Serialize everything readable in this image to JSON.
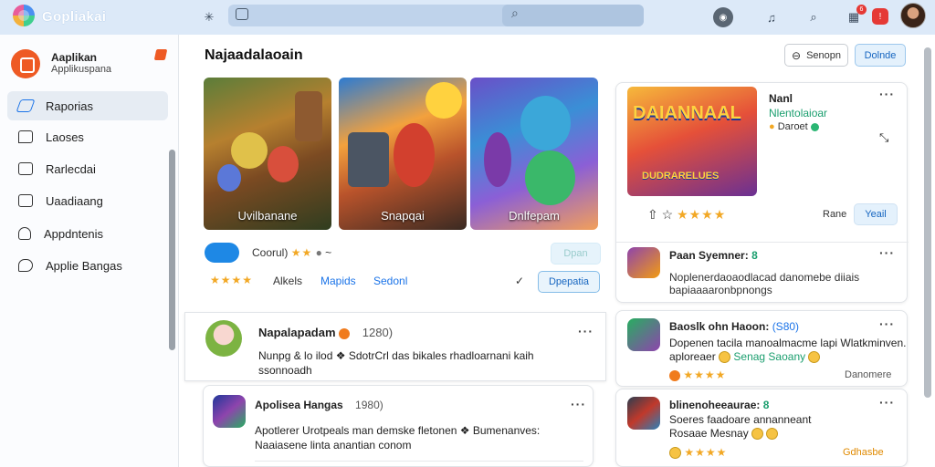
{
  "app": {
    "title": "Gopliakai"
  },
  "search": {
    "placeholder": ""
  },
  "notifications": {
    "count": "6"
  },
  "profile": {
    "name": "Aaplikan",
    "subtitle": "Applikuspana"
  },
  "sidebar": {
    "items": [
      {
        "label": "Raporias",
        "icon": "pencil-icon",
        "active": true
      },
      {
        "label": "Laoses",
        "icon": "chat-icon"
      },
      {
        "label": "Rarlecdai",
        "icon": "pencil-square-icon"
      },
      {
        "label": "Uaadiaang",
        "icon": "folder-icon"
      },
      {
        "label": "Appdntenis",
        "icon": "person-icon"
      },
      {
        "label": "Applie Bangas",
        "icon": "bubble-icon"
      }
    ]
  },
  "main": {
    "title": "Najaadalaoain",
    "header_buttons": {
      "outline": "Senopn",
      "primary": "Dolnde"
    },
    "featured": {
      "thumbnails": [
        {
          "label": "Uvilbanane"
        },
        {
          "label": "Snapqai"
        },
        {
          "label": "Dnlfepam"
        }
      ],
      "meta_label": "Coorul)",
      "meta_extra": "~",
      "disabled_button": "Dpan",
      "links": [
        "Alkels",
        "Mapids",
        "Sedonl"
      ],
      "rating_stars": "★★★★",
      "action_button": "Dpepatia",
      "chevron": "✓"
    },
    "side_feature": {
      "banner_text": "DAIANNAAL",
      "banner_sub": "DUDRARELUES",
      "title": "Nanl",
      "subtitle": "Nlentolaioar",
      "meta": "Daroet",
      "row_label": "Rane",
      "button": "Yeail",
      "stars": "★★★★"
    },
    "posts": [
      {
        "title": "Napalapadam",
        "num": "1280)",
        "body1": "Nunpg & lo ilod ❖ SdotrCrl das bikales rhadloarnani kaih",
        "body2": "ssonnoadh"
      },
      {
        "title": "Apolisea Hangas",
        "num": "1980)",
        "body1": "Apotlerer  Urotpeals man demske fletonen ❖ Bumenanves:",
        "body2": "Naaiasene linta anantian conom"
      }
    ],
    "side_posts": [
      {
        "title": "Paan Syemner:",
        "tag": "8",
        "body1": "Noplenerdaoaodlacad danomebe diiais",
        "body2": "bapiaaaaronbpnongs"
      },
      {
        "title": "Baoslk ohn Haoon:",
        "tag": "(S80)",
        "body1": "Dopenen tacila manoalmacme lapi Wlatkminven.",
        "body2": "aploreaer",
        "highlight": "Senag Saoany",
        "footer": "Danomere"
      },
      {
        "title": "blinenoheeaurae:",
        "tag": "8",
        "body1": "Soeres faadoare annanneant",
        "body2": "Rosaae Mesnay",
        "footer": "Gdhasbe"
      }
    ]
  },
  "colors": {
    "accent": "#1a73e8",
    "topbar": "#dce9f8",
    "star": "#f2a825",
    "brand_orange": "#ee5a24"
  }
}
